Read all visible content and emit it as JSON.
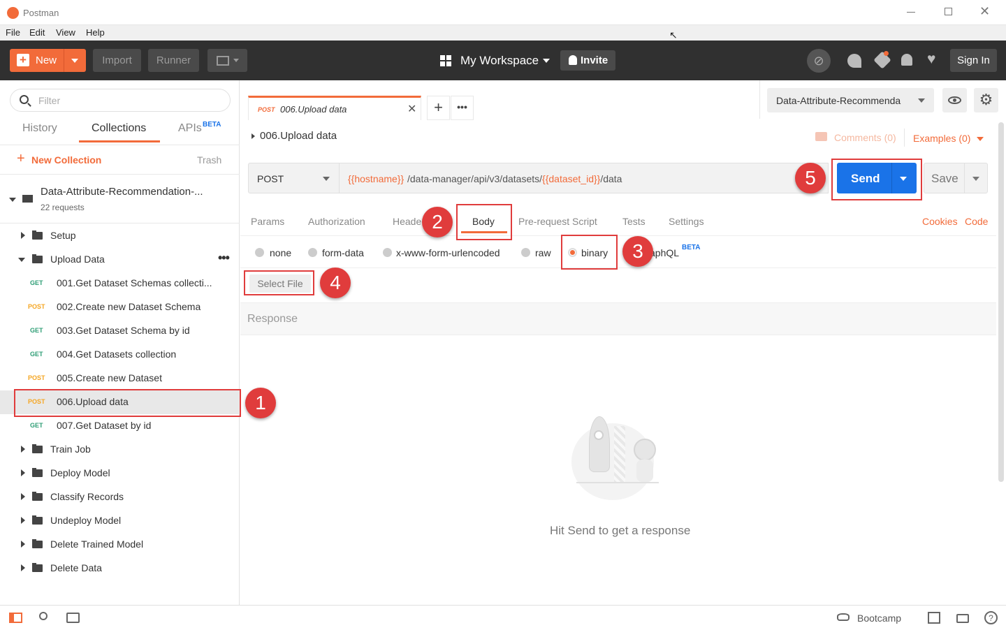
{
  "window": {
    "title": "Postman"
  },
  "menu": [
    "File",
    "Edit",
    "View",
    "Help"
  ],
  "toolbar": {
    "new_label": "New",
    "import_label": "Import",
    "runner_label": "Runner",
    "workspace_label": "My Workspace",
    "invite_label": "Invite",
    "signin_label": "Sign In"
  },
  "sidebar": {
    "filter_placeholder": "Filter",
    "tabs": {
      "history": "History",
      "collections": "Collections",
      "apis": "APIs",
      "apis_badge": "BETA"
    },
    "new_collection": "New Collection",
    "trash": "Trash",
    "collection": {
      "name": "Data-Attribute-Recommendation-...",
      "count": "22 requests"
    },
    "folders_top": [
      "Setup",
      "Upload Data"
    ],
    "requests": [
      {
        "method": "GET",
        "name": "001.Get Dataset Schemas collecti..."
      },
      {
        "method": "POST",
        "name": "002.Create new Dataset Schema"
      },
      {
        "method": "GET",
        "name": "003.Get Dataset Schema by id"
      },
      {
        "method": "GET",
        "name": "004.Get Datasets collection"
      },
      {
        "method": "POST",
        "name": "005.Create new Dataset"
      },
      {
        "method": "POST",
        "name": "006.Upload data"
      },
      {
        "method": "GET",
        "name": "007.Get Dataset by id"
      }
    ],
    "folders_bottom": [
      "Train Job",
      "Deploy Model",
      "Classify Records",
      "Undeploy Model",
      "Delete Trained Model",
      "Delete Data"
    ]
  },
  "request_tab": {
    "method": "POST",
    "name": "006.Upload data"
  },
  "request": {
    "title": "006.Upload data",
    "comments": "Comments (0)",
    "examples": "Examples (0)",
    "method": "POST",
    "url_var1": "{{hostname}}",
    "url_mid": "/data-manager/api/v3/datasets/",
    "url_var2": "{{dataset_id}}",
    "url_end": "/data",
    "send": "Send",
    "save": "Save"
  },
  "environment": "Data-Attribute-Recommenda",
  "req_tabs": [
    "Params",
    "Authorization",
    "Heade",
    "Body",
    "Pre-request Script",
    "Tests",
    "Settings"
  ],
  "req_links": {
    "cookies": "Cookies",
    "code": "Code"
  },
  "body_types": [
    "none",
    "form-data",
    "x-www-form-urlencoded",
    "raw",
    "binary",
    "aphQL"
  ],
  "graphql_badge": "BETA",
  "select_file": "Select File",
  "response": {
    "label": "Response",
    "hint": "Hit Send to get a response"
  },
  "annotations": [
    "1",
    "2",
    "3",
    "4",
    "5"
  ],
  "statusbar": {
    "bootcamp": "Bootcamp"
  },
  "colors": {
    "accent": "#f26b3a",
    "send": "#1a73e8",
    "annotation": "#e03c3c",
    "toolbar": "#303030"
  }
}
